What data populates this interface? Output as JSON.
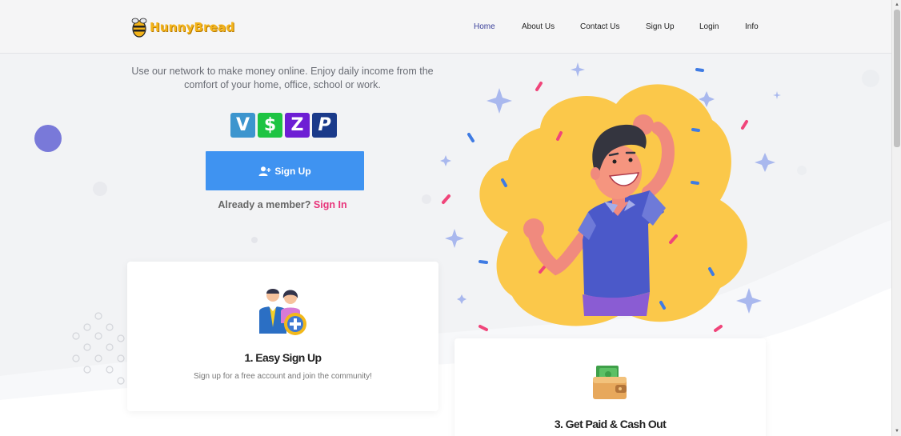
{
  "brand": {
    "name": "HunnyBread"
  },
  "nav": {
    "items": [
      {
        "label": "Home"
      },
      {
        "label": "About Us"
      },
      {
        "label": "Contact Us"
      },
      {
        "label": "Sign Up"
      },
      {
        "label": "Login"
      },
      {
        "label": "Info"
      }
    ]
  },
  "hero": {
    "tagline": "Use our network to make money online. Enjoy daily income from the comfort of your home, office, school or work.",
    "payment_methods": [
      "venmo-icon",
      "cash-app-icon",
      "zelle-icon",
      "paypal-icon"
    ],
    "signup_label": "Sign Up",
    "member_prompt": "Already a member?",
    "signin_label": "Sign In"
  },
  "steps": [
    {
      "title": "1. Easy Sign Up",
      "description": "Sign up for a free account and join the community!",
      "icon": "add-user-icon"
    },
    {
      "title": "3. Get Paid & Cash Out",
      "icon": "wallet-icon"
    }
  ],
  "colors": {
    "accent": "#3f93f1",
    "signin": "#e8337a",
    "logo": "#f4b41a",
    "active_nav": "#3a3f9a"
  }
}
